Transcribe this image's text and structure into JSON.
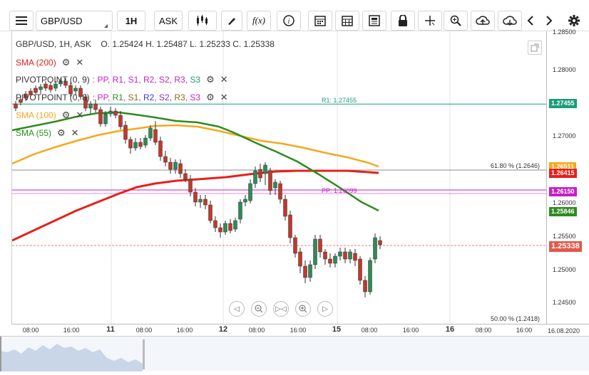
{
  "toolbar": {
    "menu_icon": "hamburger-icon",
    "symbol": "GBP/USD",
    "interval": "1H",
    "price_type": "ASK",
    "icons": [
      "candles-icon",
      "pencil-icon",
      "fx-icon",
      "info-icon",
      "calendar-icon",
      "news-icon",
      "lock-icon",
      "crosshair-icon",
      "zoom-icon",
      "upload-icon",
      "download-icon",
      "arrow-left-icon",
      "arrow-right-icon",
      "gear-icon"
    ],
    "fx_label": "f(x)"
  },
  "header": {
    "title": "GBP/USD, 1H, ASK",
    "ohlc": "O. 1.25424 H. 1.25487 L. 1.25233 C. 1.25338"
  },
  "legend": [
    {
      "name": "SMA (200)",
      "color": "#e5211b",
      "extra": ""
    },
    {
      "name": "PIVOTPOINT (0, 9)",
      "color": "#333333",
      "extra": ": PP, R1, S1, R2, S2, R3, S3"
    },
    {
      "name": "PIVOTPOINT (0, 8)",
      "color": "#333333",
      "extra": ": PP, R1, S1, R2, S2, R3, S3"
    },
    {
      "name": "SMA (100)",
      "color": "#f5a81c",
      "extra": ""
    },
    {
      "name": "SMA (55)",
      "color": "#2e8b1e",
      "extra": ""
    }
  ],
  "yaxis": {
    "ticks": [
      "1.28500",
      "1.28000",
      "1.27500",
      "1.27000",
      "1.26500",
      "1.26000",
      "1.25500",
      "1.25000",
      "1.24500"
    ]
  },
  "price_tags": [
    {
      "value": "1.27455",
      "color": "#1a9d7a"
    },
    {
      "value": "1.26511",
      "color": "#f5a81c"
    },
    {
      "value": "1.26415",
      "color": "#e5211b"
    },
    {
      "value": "1.26150",
      "color": "#c51fc5"
    },
    {
      "value": "1.25846",
      "color": "#2e8b1e"
    },
    {
      "value": "1.25338",
      "color": "#e0594a"
    }
  ],
  "annotations": {
    "r1": "R1: 1.27455",
    "fib_618": "61.80 % (1.2646)",
    "pp": "PP: 1.26099",
    "fib_50": "50.00 % (1.2418)"
  },
  "xaxis": {
    "labels": [
      "08:00",
      "16:00",
      "11",
      "08:00",
      "16:00",
      "12",
      "08:00",
      "16:00",
      "15",
      "08:00",
      "16:00",
      "16",
      "08:00",
      "16:00",
      "16.08.2020"
    ]
  },
  "zoom_controls": [
    "pan-left-icon",
    "zoom-out-icon",
    "reset-icon",
    "zoom-in-icon",
    "pan-right-icon"
  ],
  "colors": {
    "bull": "#2e8b57",
    "bear": "#c0392b",
    "sma200": "#e5211b",
    "sma100": "#f5a81c",
    "sma55": "#2e8b1e",
    "pivot_r1": "#1a9d7a",
    "pivot_pp": "#c51fc5"
  }
}
